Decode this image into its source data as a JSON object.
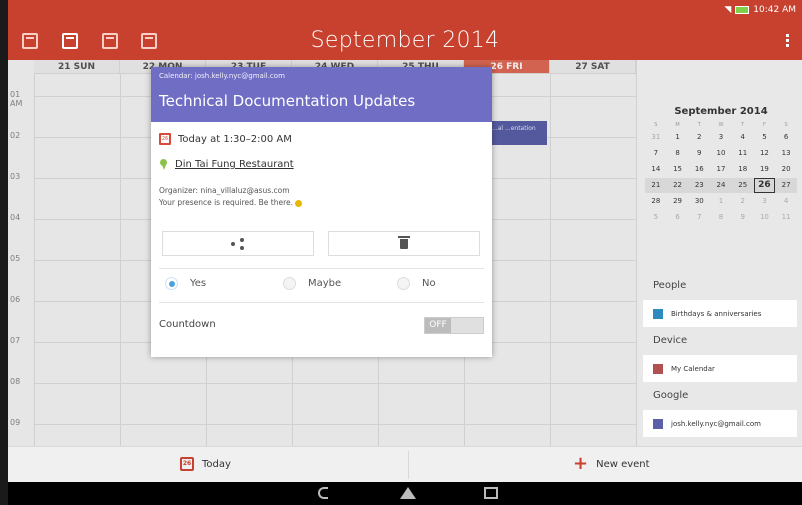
{
  "status": {
    "time": "10:42 AM"
  },
  "header": {
    "title": "September 2014"
  },
  "week": {
    "days": [
      "21 SUN",
      "22 MON",
      "23 TUE",
      "24 WED",
      "25 THU",
      "26 FRI",
      "27 SAT"
    ],
    "today_index": 5
  },
  "hours": [
    "01 AM",
    "02",
    "03",
    "04",
    "05",
    "06",
    "07",
    "08",
    "09"
  ],
  "event_block": {
    "label": "...al ...entation"
  },
  "popup": {
    "calendar": "Calendar: josh.kelly.nyc@gmail.com",
    "title": "Technical Documentation Updates",
    "time": "Today at 1:30–2:00 AM",
    "location": "Din Tai Fung Restaurant",
    "organizer": "Organizer: nina_villaluz@asus.com",
    "note": "Your presence is required. Be there.",
    "rsvp": [
      "Yes",
      "Maybe",
      "No"
    ],
    "rsvp_selected": "Yes",
    "countdown_label": "Countdown",
    "countdown_state": "OFF"
  },
  "mini_calendar": {
    "title": "September 2014",
    "weekdays": [
      "S",
      "M",
      "T",
      "W",
      "T",
      "F",
      "S"
    ],
    "weeks": [
      [
        "31",
        "1",
        "2",
        "3",
        "4",
        "5",
        "6"
      ],
      [
        "7",
        "8",
        "9",
        "10",
        "11",
        "12",
        "13"
      ],
      [
        "14",
        "15",
        "16",
        "17",
        "18",
        "19",
        "20"
      ],
      [
        "21",
        "22",
        "23",
        "24",
        "25",
        "26",
        "27"
      ],
      [
        "28",
        "29",
        "30",
        "1",
        "2",
        "3",
        "4"
      ],
      [
        "5",
        "6",
        "7",
        "8",
        "9",
        "10",
        "11"
      ]
    ],
    "selected": "26"
  },
  "sidebar": {
    "people_title": "People",
    "people_items": [
      {
        "label": "Birthdays & anniversaries",
        "color": "#2e8bc0"
      }
    ],
    "device_title": "Device",
    "device_items": [
      {
        "label": "My Calendar",
        "color": "#b05050"
      }
    ],
    "google_title": "Google",
    "google_items": [
      {
        "label": "josh.kelly.nyc@gmail.com",
        "color": "#5a5fa8"
      }
    ]
  },
  "bottombar": {
    "today_label": "Today",
    "new_event_label": "New event",
    "today_icon_text": "26"
  }
}
